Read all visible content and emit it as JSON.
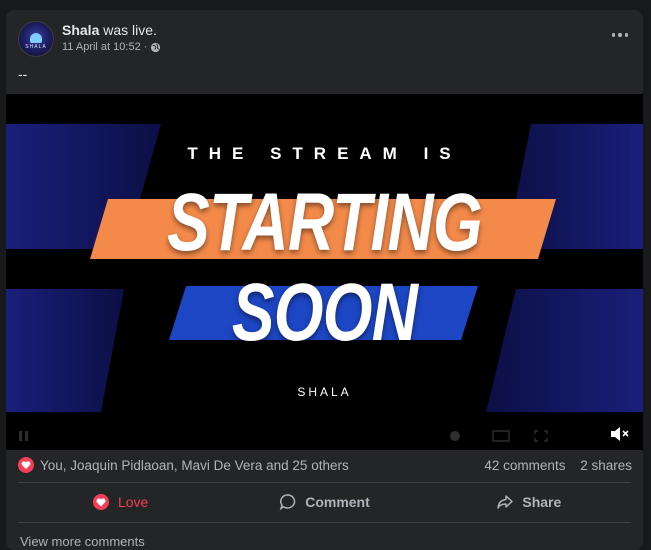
{
  "post": {
    "author": "Shala",
    "action_text": "was live.",
    "timestamp": "11 April at 10:52",
    "separator": "·",
    "privacy_icon": "globe-icon",
    "caption": "--",
    "avatar_label": "SHALA"
  },
  "video": {
    "line1": "THE STREAM IS",
    "line2": "STARTING",
    "line3": "SOON",
    "channel": "SHALA",
    "colors": {
      "orange": "#f48a4a",
      "blue": "#1d46c4",
      "dark_blue": "#141a6b",
      "background": "#000000"
    },
    "mute_icon": "muted-speaker-icon"
  },
  "reactions": {
    "icon": "love-reaction-icon",
    "summary": "You, Joaquin Pidlaoan, Mavi De Vera and 25 others",
    "comments": "42 comments",
    "shares": "2 shares"
  },
  "actions": {
    "love": "Love",
    "comment": "Comment",
    "share": "Share"
  },
  "footer": {
    "view_more": "View more comments"
  },
  "theme": {
    "card": "#242526",
    "page": "#18191a",
    "text": "#e4e6eb",
    "secondary": "#b0b3b8",
    "love": "#f33e58"
  }
}
